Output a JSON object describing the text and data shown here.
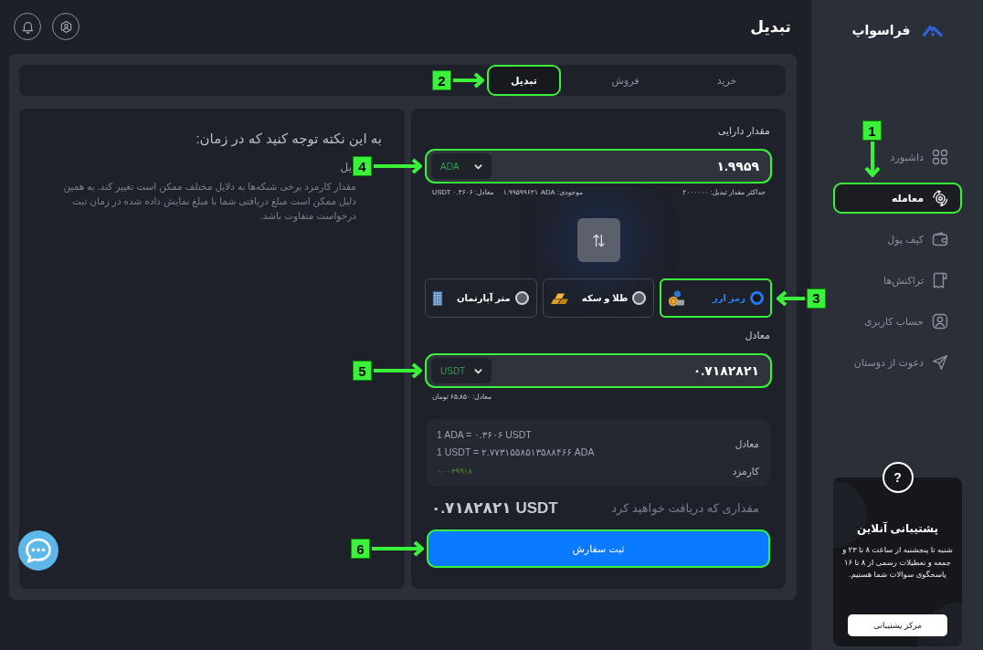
{
  "sidebar": {
    "logo": "فراسواپ",
    "nav": [
      {
        "label": "داشبورد",
        "selected": false,
        "highlighted": false
      },
      {
        "label": "معامله",
        "selected": true,
        "highlighted": true,
        "callout": "1"
      },
      {
        "label": "کیف پول",
        "selected": false,
        "highlighted": false
      },
      {
        "label": "تراکنش‌ها",
        "selected": false,
        "highlighted": false
      },
      {
        "label": "حساب کاربری",
        "selected": false,
        "highlighted": false
      },
      {
        "label": "دعوت از دوستان",
        "selected": false,
        "highlighted": false
      }
    ],
    "support": {
      "icon_text": "?",
      "title": "پشتیبانی آنلاین",
      "text": "شنبه تا پنجشنبه از ساعت ۸ تا ۲۳ و جمعه و تعطیلات رسمی از ۸ تا ۱۶ پاسخگوی سوالات شما هستیم.",
      "button": "مرکز پشتیبانی"
    }
  },
  "header": {
    "title": "تبدیل"
  },
  "tabs": [
    {
      "label": "خرید",
      "selected": false,
      "highlighted": false
    },
    {
      "label": "فروش",
      "selected": false,
      "highlighted": false
    },
    {
      "label": "تبدیل",
      "selected": true,
      "highlighted": true,
      "callout": "2"
    }
  ],
  "form": {
    "from": {
      "label": "مقدار دارایی",
      "value": "۱.۹۹۵۹",
      "currency": "ADA",
      "highlighted": true,
      "callout": "4",
      "limit": "حداکثر مقدار تبدیل: ۲۰۰۰۰۰۰",
      "balance": {
        "label": "موجودی:",
        "currency": "ADA",
        "amount": "۱.۹۹۵۹۹۶۲۱"
      },
      "equivalent": "معادل: ۰.۳۶۰۶ USDT"
    },
    "asset_types": [
      {
        "label": "رمز ارز",
        "kind": "crypto",
        "selected": true,
        "highlighted": true,
        "callout": "3"
      },
      {
        "label": "طلا و سکه",
        "kind": "gold",
        "selected": false,
        "highlighted": false
      },
      {
        "label": "متر آپارتمان",
        "kind": "property",
        "selected": false,
        "highlighted": false
      }
    ],
    "to": {
      "label": "معادل",
      "value": "۰.۷۱۸۲۸۲۱",
      "currency": "USDT",
      "highlighted": true,
      "callout": "5",
      "equivalent": "معادل: ۶۵,۸۵۰ تومان"
    },
    "rates": {
      "label": "معادل",
      "lines": [
        "1 ADA = ۰.۳۶۰۶ USDT",
        "1 USDT = ۲.۷۷۳۱۵۵۸۵۱۳۵۸۸۴۶۶ ADA"
      ]
    },
    "fee": {
      "label": "کارمزد",
      "value": "۰.۰۰۳۹۹۱۸"
    },
    "receive": {
      "label": "مقداری که دریافت خواهید کرد",
      "amount": "۰.۷۱۸۲۸۲۱ USDT"
    },
    "submit": {
      "label": "ثبت سفارش",
      "highlighted": true,
      "callout": "6"
    }
  },
  "notice": {
    "title": "به این نکته توجه کنید که در زمان:",
    "items": [
      {
        "heading": "یل",
        "text": "مقدار کارمزد برخی شبکه‌ها به دلایل مختلف ممکن است تغییر کند. به همین دلیل ممکن است مبلغ دریافتی شما با مبلغ نمایش داده شده در زمان ثبت درخواست متفاوت باشد."
      }
    ]
  }
}
